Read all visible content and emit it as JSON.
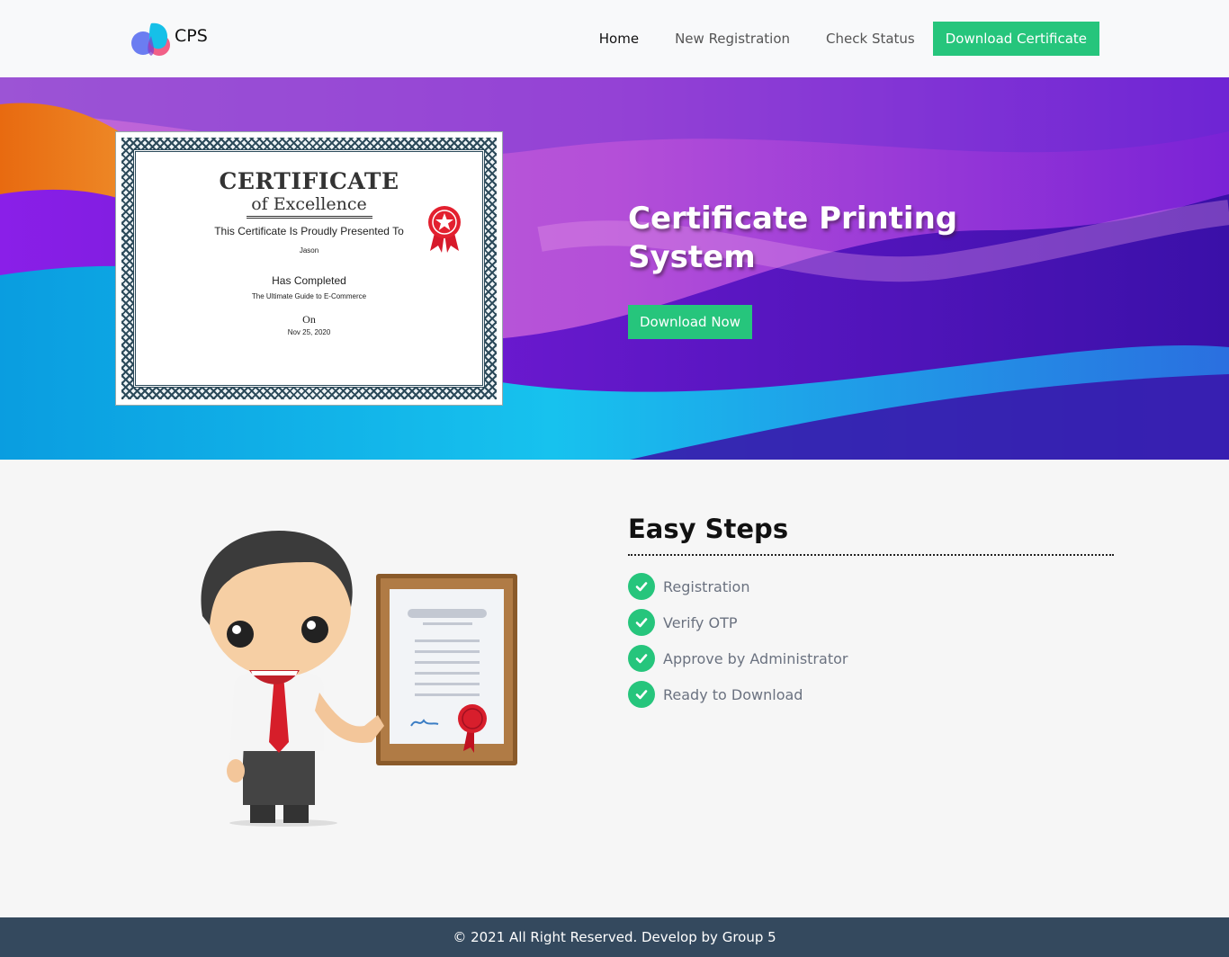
{
  "header": {
    "logo_text": "CPS",
    "nav": {
      "home": "Home",
      "new_registration": "New Registration",
      "check_status": "Check Status",
      "download_certificate": "Download Certificate"
    }
  },
  "hero": {
    "title": "Certificate Printing System",
    "button": "Download Now",
    "certificate": {
      "title": "CERTIFICATE",
      "subtitle": "of Excellence",
      "presented": "This Certificate Is Proudly Presented To",
      "name": "Jason",
      "completed": "Has Completed",
      "course": "The Ultimate Guide to E-Commerce",
      "on": "On",
      "date": "Nov 25, 2020"
    }
  },
  "steps": {
    "title": "Easy Steps",
    "items": [
      {
        "label": "Registration"
      },
      {
        "label": "Verify OTP"
      },
      {
        "label": "Approve by Administrator"
      },
      {
        "label": "Ready to Download"
      }
    ]
  },
  "footer": {
    "text": "© 2021 All Right Reserved. Develop by Group 5"
  },
  "colors": {
    "accent": "#26c57c",
    "footer_bg": "#34495e",
    "header_bg": "#f8f9fa"
  }
}
